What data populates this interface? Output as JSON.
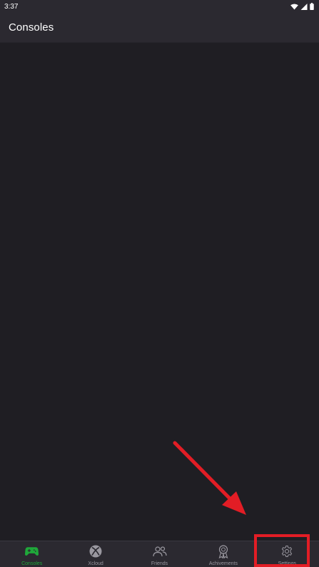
{
  "status_bar": {
    "time": "3:37",
    "icons": [
      "wifi-icon",
      "signal-icon",
      "battery-icon"
    ]
  },
  "app_bar": {
    "title": "Consoles"
  },
  "bottom_nav": {
    "items": [
      {
        "label": "Consoles",
        "icon": "gamepad-icon",
        "active": true
      },
      {
        "label": "Xcloud",
        "icon": "xbox-icon",
        "active": false
      },
      {
        "label": "Friends",
        "icon": "friends-icon",
        "active": false
      },
      {
        "label": "Achivements",
        "icon": "award-icon",
        "active": false
      },
      {
        "label": "Settings",
        "icon": "gear-icon",
        "active": false
      }
    ]
  },
  "annotation": {
    "highlight_color": "#e21d25",
    "target": "Settings"
  },
  "colors": {
    "accent": "#1fa83a",
    "background": "#1f1e23",
    "bar": "#2b2930",
    "inactive": "#9a98a0"
  }
}
